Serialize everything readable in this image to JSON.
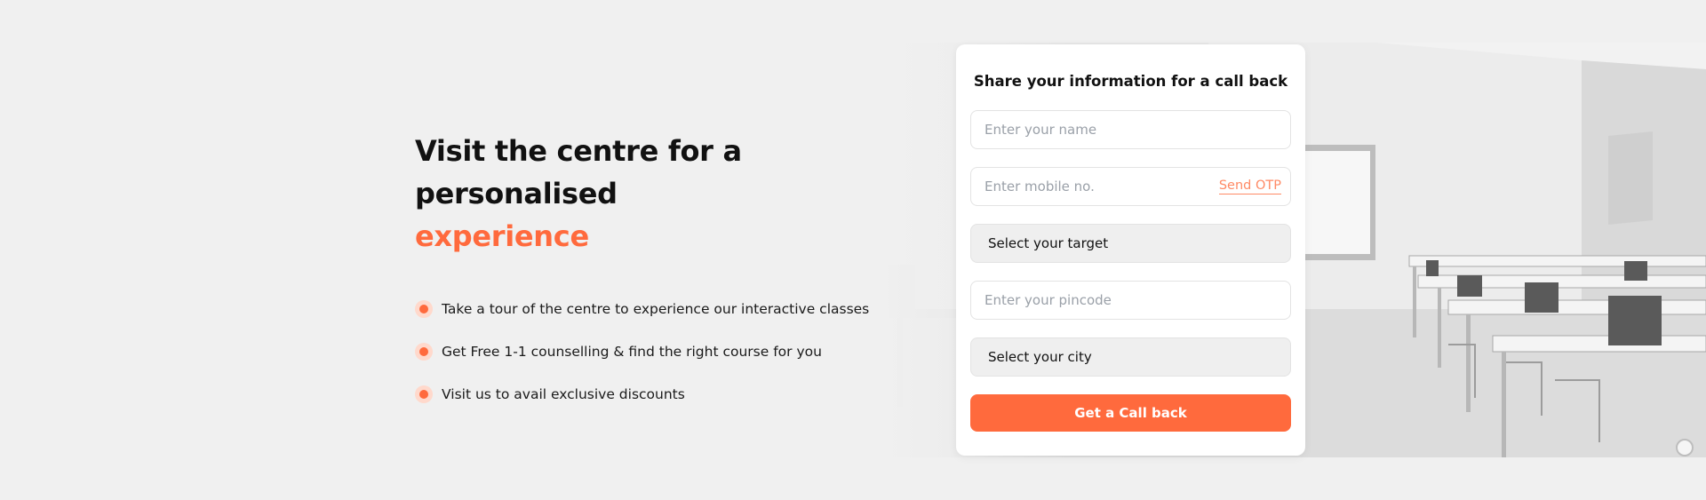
{
  "hero": {
    "headline_line1": "Visit the centre for a personalised",
    "headline_accent": "experience",
    "accent_color": "#ff6a3d",
    "bullets": [
      "Take a tour of the centre to experience our interactive classes",
      "Get Free 1-1 counselling & find the right course for you",
      "Visit us to avail exclusive discounts"
    ]
  },
  "form": {
    "title": "Share your information for a call back",
    "name_placeholder": "Enter your name",
    "mobile_placeholder": "Enter mobile no.",
    "send_otp_label": "Send OTP",
    "target_label": "Select your target",
    "pincode_placeholder": "Enter your pincode",
    "city_label": "Select your city",
    "submit_label": "Get a Call back"
  }
}
